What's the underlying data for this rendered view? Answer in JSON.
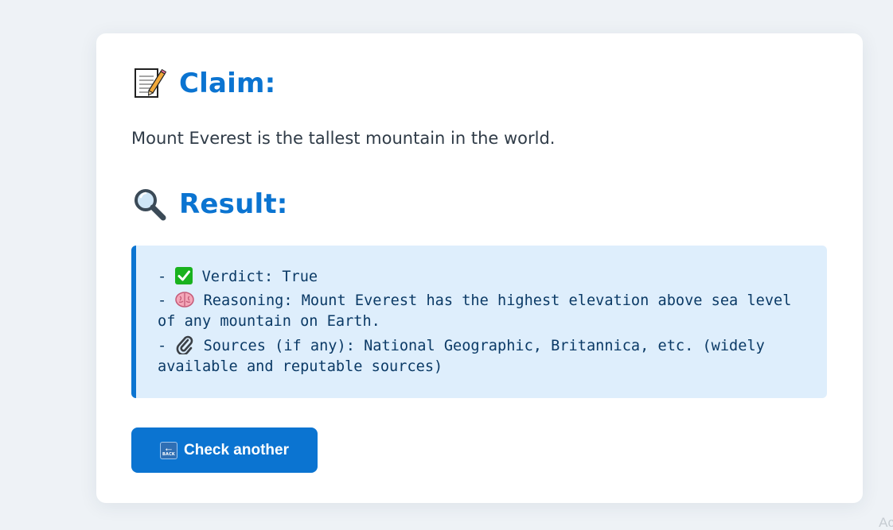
{
  "claim": {
    "icon": "memo-icon",
    "heading": "Claim:",
    "text": "Mount Everest is the tallest mountain in the world."
  },
  "result": {
    "icon": "magnifying-glass-icon",
    "heading": "Result:",
    "lines": [
      {
        "prefix": "- ",
        "icon": "check-mark-icon",
        "text": " Verdict: True"
      },
      {
        "prefix": "- ",
        "icon": "brain-icon",
        "text": " Reasoning: Mount Everest has the highest elevation above sea level of any mountain on Earth."
      },
      {
        "prefix": "- ",
        "icon": "paperclip-icon",
        "text": " Sources (if any): National Geographic, Britannica, etc. (widely available and reputable sources)"
      }
    ]
  },
  "back_button": {
    "icon": "back-arrow-icon",
    "icon_text": "BACK",
    "label": "Check another"
  },
  "corner_text": "Ac",
  "colors": {
    "accent": "#0b74d1",
    "result_bg": "#deeefc",
    "result_text": "#0b3a66",
    "page_bg": "#eef2f6"
  }
}
